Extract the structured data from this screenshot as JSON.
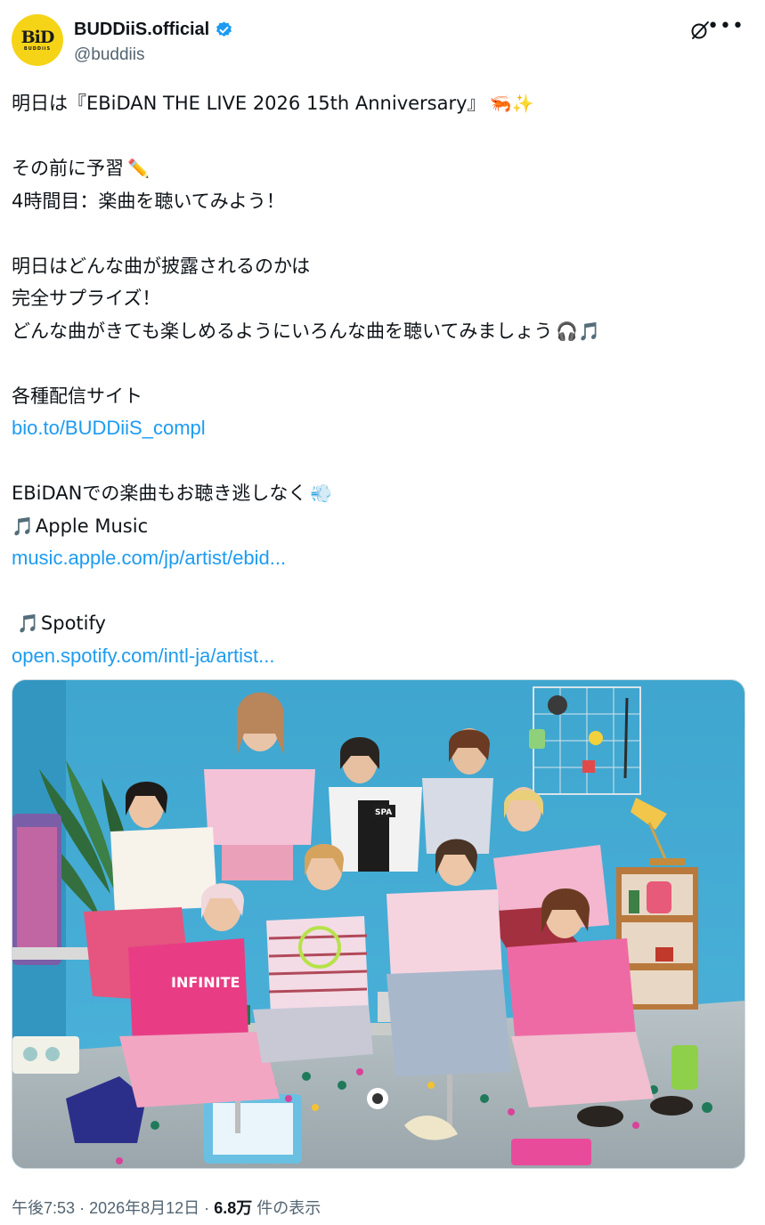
{
  "author": {
    "display_name": "BUDDiiS.official",
    "handle": "@buddiis",
    "avatar_text": "BiD",
    "avatar_subtext": "BUDDiiS",
    "avatar_color": "#f5d417",
    "verified_color": "#1d9bf0"
  },
  "post": {
    "line1": "明日は『EBiDAN THE LIVE 2026 15th Anniversary』",
    "line1_emoji": "🦐✨",
    "line2": "その前に予習",
    "line2_emoji": "✏️",
    "line3": "4時間目：楽曲を聴いてみよう！",
    "line4": "明日はどんな曲が披露されるのかは",
    "line5": "完全サプライズ！",
    "line6": "どんな曲がきても楽しめるようにいろんな曲を聴いてみましょう",
    "line6_emoji": "🎧🎵",
    "line7": "各種配信サイト",
    "link1": "bio.to/BUDDiiS_compl",
    "line8": "EBiDANでの楽曲もお聴き逃しなく",
    "line8_emoji": "💨",
    "apple_music_label": "Apple Music",
    "link2": "music.apple.com/jp/artist/ebid...",
    "spotify_label": "Spotify",
    "link3": "open.spotify.com/intl-ja/artist...",
    "note_emoji": "🎵"
  },
  "image": {
    "shirt_text": "INFINITE",
    "bag_text": "SPA",
    "background_color": "#3fa6cf"
  },
  "footer": {
    "time": "午後7:53",
    "separator": "·",
    "date": "2026年8月12日",
    "views_count": "6.8万",
    "views_label": "件の表示"
  },
  "colors": {
    "link": "#1d9bf0",
    "text": "#0f1419",
    "secondary": "#536471"
  }
}
